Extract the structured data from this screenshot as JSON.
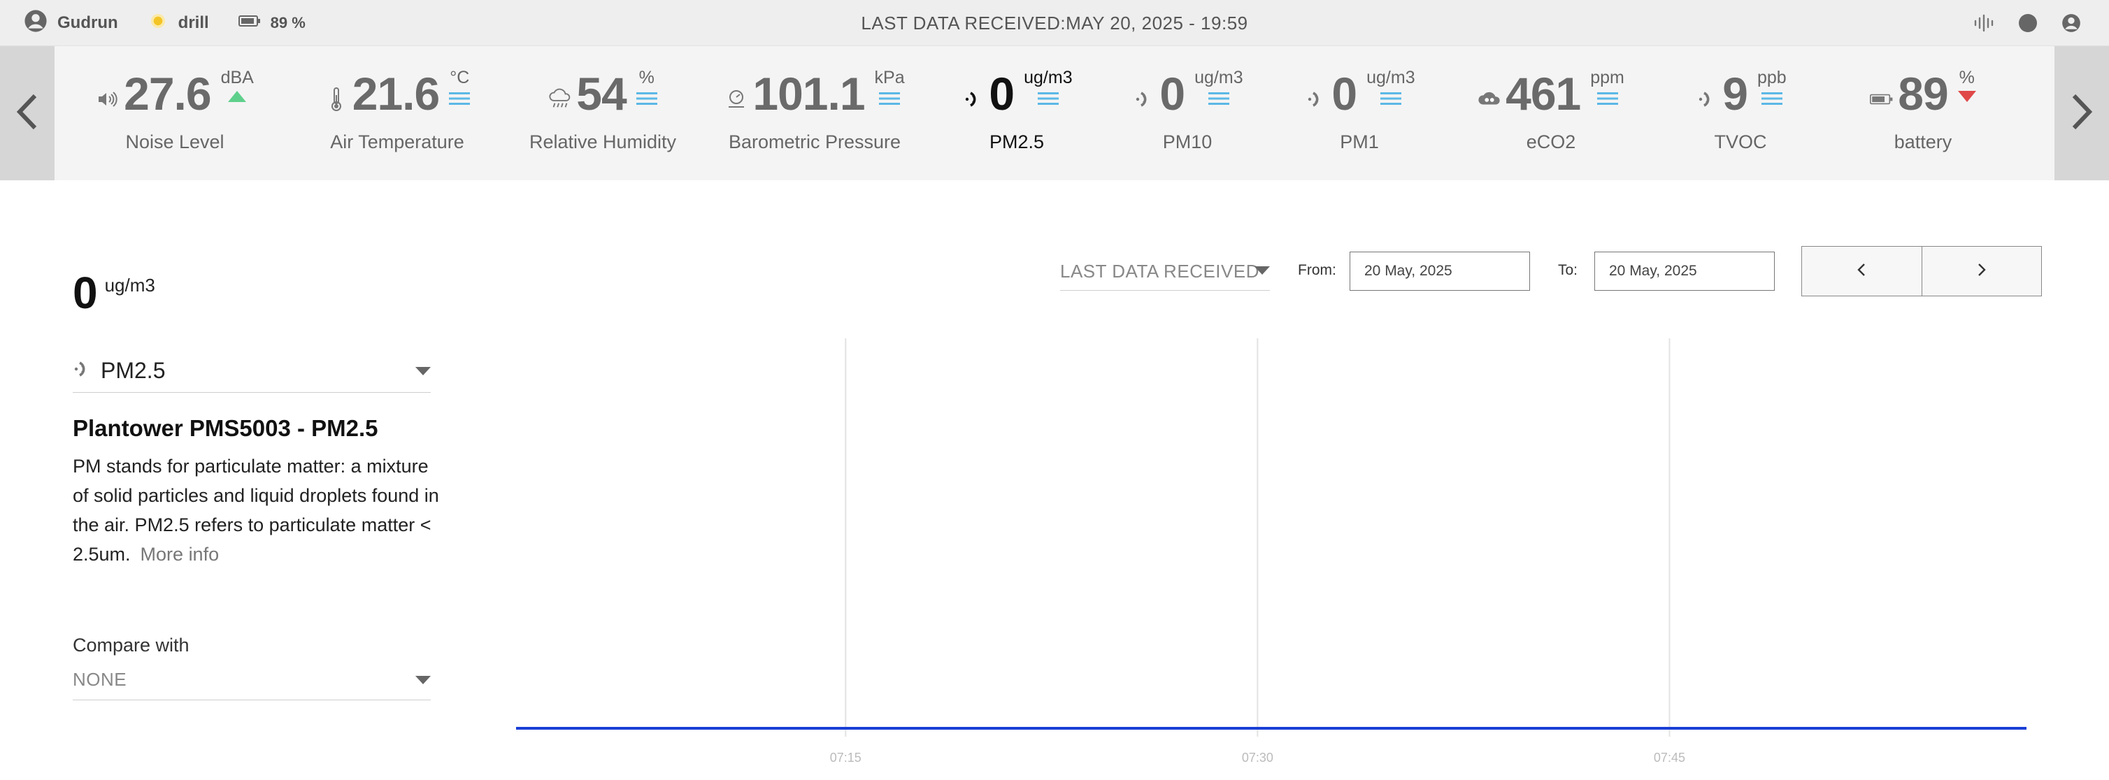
{
  "topbar": {
    "user": "Gudrun",
    "mode": "drill",
    "battery": "89 %",
    "last_data": "LAST DATA RECEIVED:MAY 20, 2025 - 19:59"
  },
  "sensors": [
    {
      "value": "27.6",
      "unit": "dBA",
      "label": "Noise Level",
      "icon": "speaker-icon",
      "trend": "up"
    },
    {
      "value": "21.6",
      "unit": "°C",
      "label": "Air Temperature",
      "icon": "thermometer-icon",
      "trend": "stable"
    },
    {
      "value": "54",
      "unit": "%",
      "label": "Relative Humidity",
      "icon": "rain-cloud-icon",
      "trend": "stable"
    },
    {
      "value": "101.1",
      "unit": "kPa",
      "label": "Barometric Pressure",
      "icon": "gauge-icon",
      "trend": "stable"
    },
    {
      "value": "0",
      "unit": "ug/m3",
      "label": "PM2.5",
      "icon": "particles-icon",
      "trend": "stable",
      "active": true
    },
    {
      "value": "0",
      "unit": "ug/m3",
      "label": "PM10",
      "icon": "particles-icon",
      "trend": "stable"
    },
    {
      "value": "0",
      "unit": "ug/m3",
      "label": "PM1",
      "icon": "particles-icon",
      "trend": "stable"
    },
    {
      "value": "461",
      "unit": "ppm",
      "label": "eCO2",
      "icon": "co2-cloud-icon",
      "trend": "stable"
    },
    {
      "value": "9",
      "unit": "ppb",
      "label": "TVOC",
      "icon": "particles-icon",
      "trend": "stable"
    },
    {
      "value": "89",
      "unit": "%",
      "label": "battery",
      "icon": "battery-icon",
      "trend": "down"
    }
  ],
  "colors": {
    "trend_up": "#5fd08c",
    "trend_stable": "#5bb8e6",
    "trend_down": "#e04848",
    "chart_line": "#1a3fd6"
  },
  "panel": {
    "current_value": "0",
    "current_unit": "ug/m3",
    "selected_sensor": "PM2.5",
    "title": "Plantower PMS5003 - PM2.5",
    "description": "PM stands for particulate matter: a mixture of solid particles and liquid droplets found in the air. PM2.5 refers to particulate matter < 2.5um.",
    "more_info": "More info",
    "compare_label": "Compare with",
    "compare_value": "NONE"
  },
  "controls": {
    "range": "LAST DATA RECEIVED",
    "from_label": "From:",
    "from_value": "20 May, 2025",
    "to_label": "To:",
    "to_value": "20 May, 2025"
  },
  "chart_data": {
    "type": "line",
    "title": "",
    "xlabel": "",
    "ylabel": "",
    "x_ticks": [
      "07:15",
      "07:30",
      "07:45"
    ],
    "grid": "vertical",
    "series": [
      {
        "x": [
          "07:03",
          "07:58"
        ],
        "values": [
          0,
          0
        ]
      }
    ]
  }
}
